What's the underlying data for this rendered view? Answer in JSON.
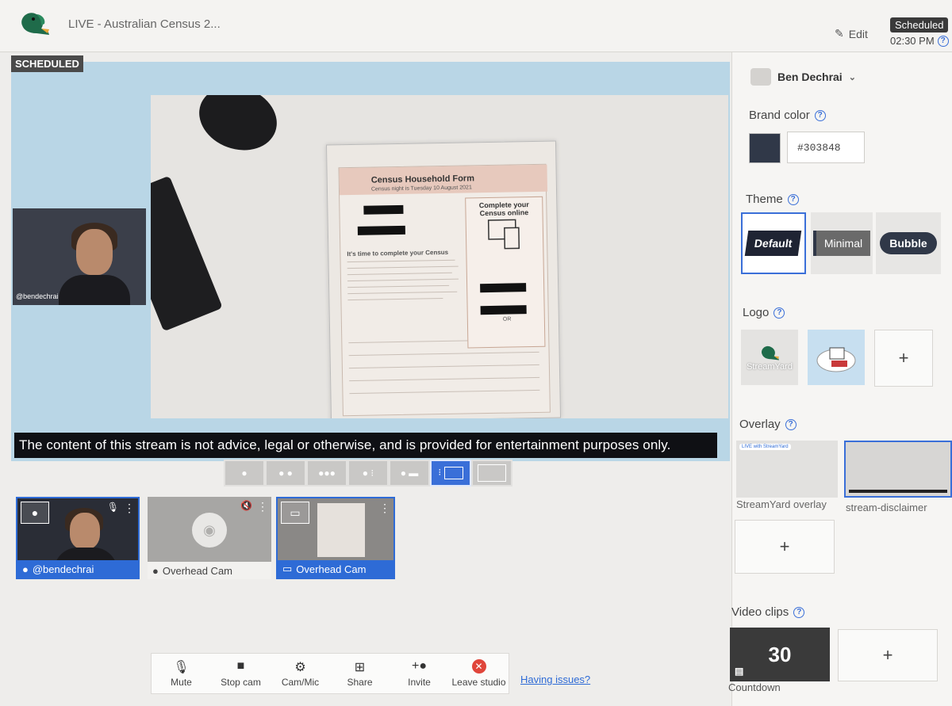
{
  "header": {
    "title": "LIVE - Australian Census 2...",
    "edit_label": "Edit",
    "status_badge": "Scheduled",
    "scheduled_time": "02:30 PM"
  },
  "stage": {
    "scheduled_label": "SCHEDULED",
    "webcam_handle": "@bendechrai",
    "disclaimer": "The content of this stream is not advice, legal or otherwise, and is provided for entertainment purposes only.",
    "census_form": {
      "title": "Census Household Form",
      "subtitle": "Census night is Tuesday 10 August 2021",
      "column_title": "Complete your Census online",
      "heading": "It's time to complete your Census",
      "or_text": "OR"
    }
  },
  "layouts": [
    "solo",
    "two",
    "three",
    "four",
    "side",
    "overlay",
    "blank"
  ],
  "sources": [
    {
      "label": "@bendechrai",
      "icon": "person-icon",
      "on_stage": true
    },
    {
      "label": "Overhead Cam",
      "icon": "person-icon",
      "on_stage": false
    },
    {
      "label": "Overhead Cam",
      "icon": "screen-icon",
      "on_stage": true
    }
  ],
  "controls": {
    "mute": "Mute",
    "stop_cam": "Stop cam",
    "cam_mic": "Cam/Mic",
    "share": "Share",
    "invite": "Invite",
    "leave": "Leave studio",
    "help_link": "Having issues?"
  },
  "panel": {
    "user_name": "Ben Dechrai",
    "brand_color_title": "Brand color",
    "brand_color_value": "#303848",
    "theme_title": "Theme",
    "themes": [
      "Default",
      "Minimal",
      "Bubble"
    ],
    "logo_title": "Logo",
    "logo_streamyard_text": "StreamYard",
    "overlay_title": "Overlay",
    "overlays": [
      "StreamYard overlay",
      "stream-disclaimer"
    ],
    "overlay_preview_text": "LIVE with StreamYard",
    "video_clips_title": "Video clips",
    "clip_value": "30",
    "clip_label": "Countdown",
    "add_symbol": "+"
  },
  "colors": {
    "accent": "#3a6fd8",
    "brand": "#303848",
    "leave": "#e0453a"
  }
}
